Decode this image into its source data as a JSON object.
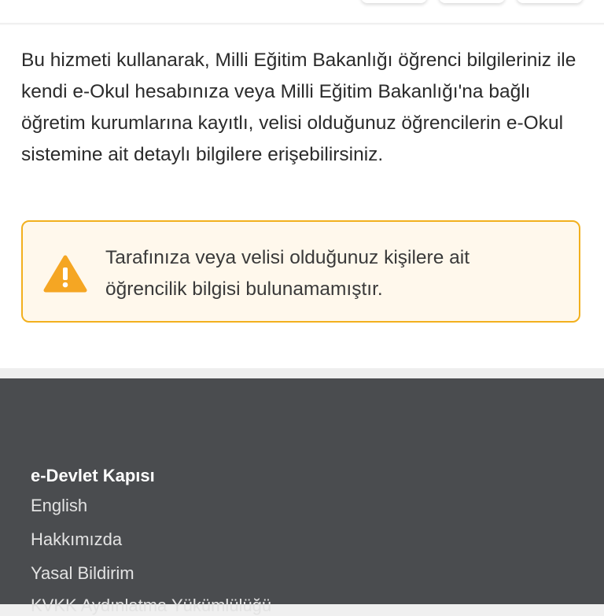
{
  "description": "Bu hizmeti kullanarak, Milli Eğitim Bakanlığı öğrenci bilgileriniz ile kendi e-Okul hesabınıza veya Milli Eğitim Bakanlığı'na bağlı öğretim kurumlarına kayıtlı, velisi olduğunuz öğrencilerin e-Okul sistemine ait detaylı bilgilere erişebilirsiniz.",
  "warning": {
    "icon": "warning-triangle-icon",
    "text": "Tarafınıza veya velisi olduğunuz kişilere ait öğrencilik bilgisi bulunamamıştır.",
    "border_color": "#f2b01e",
    "icon_color": "#f5a623"
  },
  "footer": {
    "title": "e-Devlet Kapısı",
    "links": [
      "English",
      "Hakkımızda",
      "Yasal Bildirim",
      "KVKK Aydınlatma Yükümlülüğü"
    ],
    "background": "#4a4c4f"
  }
}
